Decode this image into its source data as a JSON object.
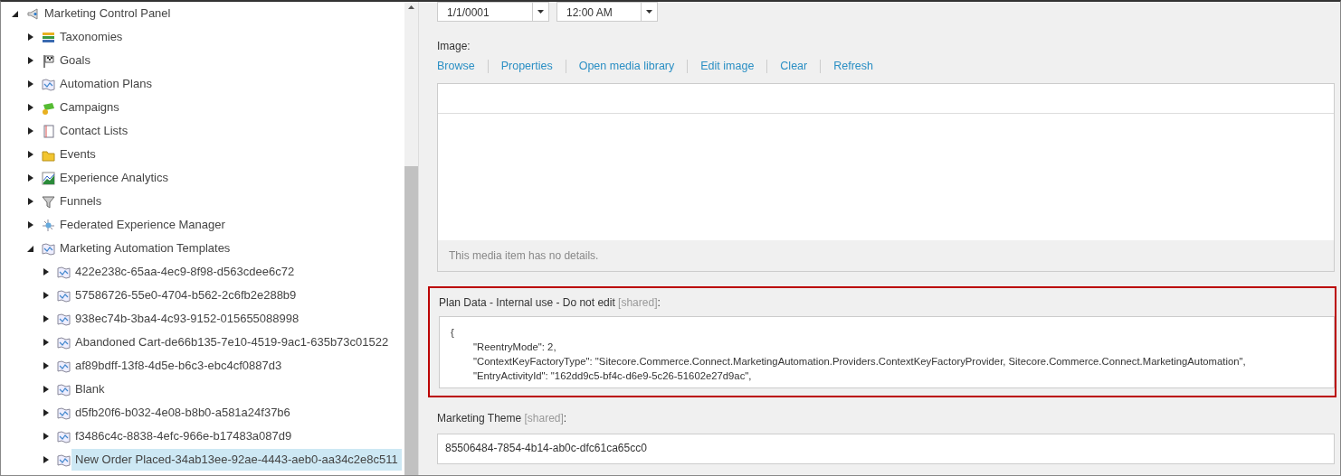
{
  "tree": [
    {
      "label": "Marketing Control Panel",
      "kind": "panel",
      "expanded": true,
      "selected": false,
      "children": [
        {
          "label": "Taxonomies",
          "kind": "taxonomy",
          "expanded": false,
          "selected": false
        },
        {
          "label": "Goals",
          "kind": "goal",
          "expanded": false,
          "selected": false
        },
        {
          "label": "Automation Plans",
          "kind": "plan",
          "expanded": false,
          "selected": false
        },
        {
          "label": "Campaigns",
          "kind": "campaign",
          "expanded": false,
          "selected": false
        },
        {
          "label": "Contact Lists",
          "kind": "list",
          "expanded": false,
          "selected": false
        },
        {
          "label": "Events",
          "kind": "event",
          "expanded": false,
          "selected": false
        },
        {
          "label": "Experience Analytics",
          "kind": "analytics",
          "expanded": false,
          "selected": false
        },
        {
          "label": "Funnels",
          "kind": "funnel",
          "expanded": false,
          "selected": false
        },
        {
          "label": "Federated Experience Manager",
          "kind": "federated",
          "expanded": false,
          "selected": false
        },
        {
          "label": "Marketing Automation Templates",
          "kind": "plan",
          "expanded": true,
          "selected": false,
          "children": [
            {
              "label": "422e238c-65aa-4ec9-8f98-d563cdee6c72",
              "kind": "plan",
              "expanded": false,
              "selected": false
            },
            {
              "label": "57586726-55e0-4704-b562-2c6fb2e288b9",
              "kind": "plan",
              "expanded": false,
              "selected": false
            },
            {
              "label": "938ec74b-3ba4-4c93-9152-015655088998",
              "kind": "plan",
              "expanded": false,
              "selected": false
            },
            {
              "label": "Abandoned Cart-de66b135-7e10-4519-9ac1-635b73c01522",
              "kind": "plan",
              "expanded": false,
              "selected": false
            },
            {
              "label": "af89bdff-13f8-4d5e-b6c3-ebc4cf0887d3",
              "kind": "plan",
              "expanded": false,
              "selected": false
            },
            {
              "label": "Blank",
              "kind": "plan",
              "expanded": false,
              "selected": false
            },
            {
              "label": "d5fb20f6-b032-4e08-b8b0-a581a24f37b6",
              "kind": "plan",
              "expanded": false,
              "selected": false
            },
            {
              "label": "f3486c4c-8838-4efc-966e-b17483a087d9",
              "kind": "plan",
              "expanded": false,
              "selected": false
            },
            {
              "label": "New Order Placed-34ab13ee-92ae-4443-aeb0-aa34c2e8c511",
              "kind": "plan",
              "expanded": false,
              "selected": true
            }
          ]
        }
      ]
    }
  ],
  "editor": {
    "date_value": "1/1/0001",
    "time_value": "12:00 AM",
    "image": {
      "label": "Image:",
      "links": [
        "Browse",
        "Properties",
        "Open media library",
        "Edit image",
        "Clear",
        "Refresh"
      ],
      "details": "This media item has no details."
    },
    "plan_data": {
      "label": "Plan Data - Internal use - Do not edit",
      "tag": "[shared]",
      "suffix": ":",
      "highlighted": true,
      "opening": "{",
      "entries": [
        "\"ReentryMode\": 2,",
        "\"ContextKeyFactoryType\": \"Sitecore.Commerce.Connect.MarketingAutomation.Providers.ContextKeyFactoryProvider, Sitecore.Commerce.Connect.MarketingAutomation\",",
        "\"EntryActivityId\": \"162dd9c5-bf4c-d6e9-5c26-51602e27d9ac\","
      ]
    },
    "marketing_theme": {
      "label": "Marketing Theme",
      "tag": "[shared]",
      "suffix": ":",
      "value": "85506484-7854-4b14-ab0c-dfc61ca65cc0"
    }
  }
}
